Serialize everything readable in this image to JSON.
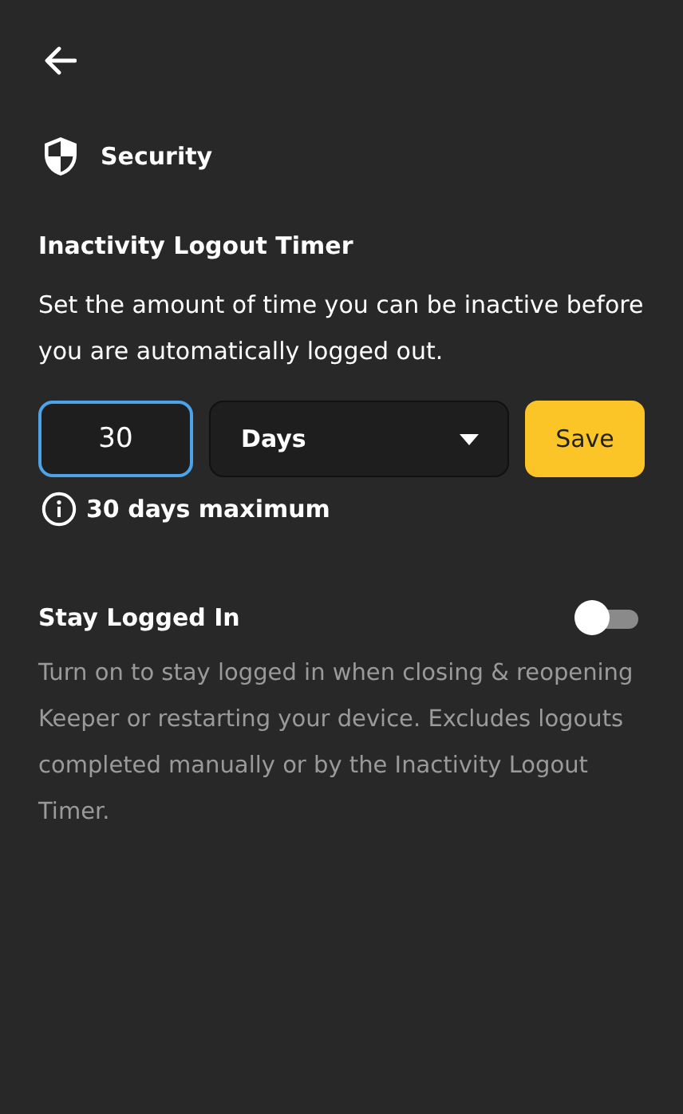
{
  "header": {
    "title": "Security"
  },
  "timer": {
    "heading": "Inactivity Logout Timer",
    "description": "Set the amount of time you can be inactive before you are automatically logged out.",
    "amount": {
      "value": "30",
      "focused": true
    },
    "unit": {
      "value": "Days"
    },
    "save_button": "Save",
    "hint": "30 days maximum"
  },
  "stay_logged_in": {
    "label": "Stay Logged In",
    "on": false,
    "description": "Turn on to stay logged in when closing & reopening Keeper or restarting your device. Excludes logouts completed manually or by the Inactivity Logout Timer."
  }
}
